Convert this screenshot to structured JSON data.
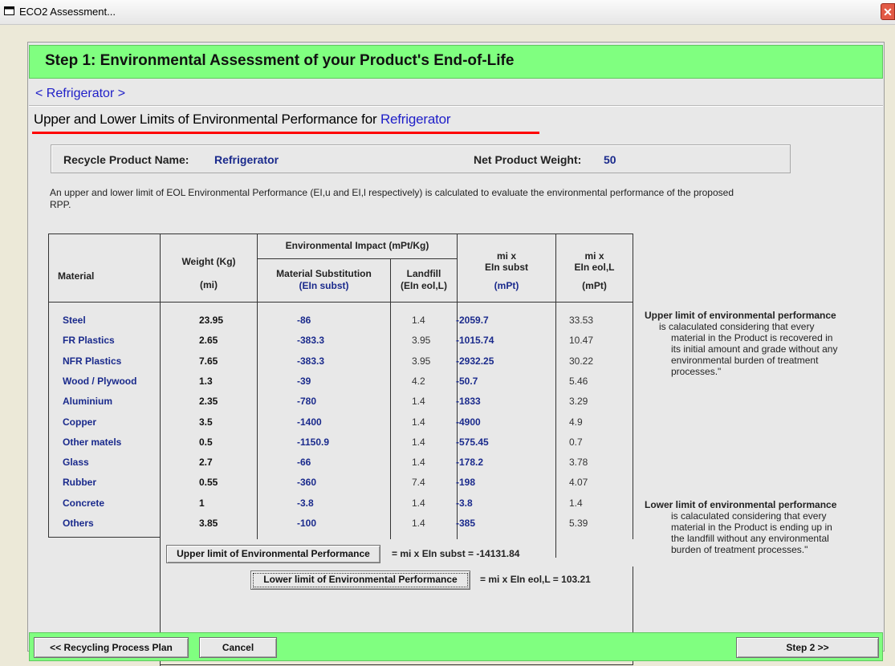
{
  "window": {
    "title": "ECO2 Assessment...",
    "close_glyph": "✕"
  },
  "header": {
    "title": "Step 1: Environmental Assessment of your Product's End-of-Life"
  },
  "breadcrumb": "< Refrigerator >",
  "section": {
    "heading_prefix": "Upper and Lower Limits of Environmental Performance for ",
    "heading_product": "Refrigerator"
  },
  "info": {
    "product_label": "Recycle Product Name:",
    "product_value": "Refrigerator",
    "weight_label": "Net Product Weight:",
    "weight_value": "50"
  },
  "description": "An upper and lower limit of EOL Environmental Performance (EI,u and EI,l respectively) is calculated to evaluate the environmental performance of the proposed RPP.",
  "table": {
    "headers": {
      "material": "Material",
      "weight": "Weight (Kg)",
      "weight_sub": "(mi)",
      "impact_group": "Environmental Impact (mPt/Kg)",
      "subst": "Material Substitution",
      "subst_sub": "(EIn subst)",
      "landfill": "Landfill",
      "landfill_sub": "(EIn eol,L)",
      "mi_subst_1": "mi x",
      "mi_subst_2": "EIn subst",
      "mi_subst_3": "(mPt)",
      "mi_eol_1": "mi x",
      "mi_eol_2": "EIn eol,L",
      "mi_eol_3": "(mPt)"
    },
    "rows": [
      {
        "material": "Steel",
        "weight": "23.95",
        "subst": "-86",
        "landfill": "1.4",
        "mi_subst": "-2059.7",
        "mi_eol": "33.53"
      },
      {
        "material": "FR Plastics",
        "weight": "2.65",
        "subst": "-383.3",
        "landfill": "3.95",
        "mi_subst": "-1015.74",
        "mi_eol": "10.47"
      },
      {
        "material": "NFR Plastics",
        "weight": "7.65",
        "subst": "-383.3",
        "landfill": "3.95",
        "mi_subst": "-2932.25",
        "mi_eol": "30.22"
      },
      {
        "material": "Wood / Plywood",
        "weight": "1.3",
        "subst": "-39",
        "landfill": "4.2",
        "mi_subst": "-50.7",
        "mi_eol": "5.46"
      },
      {
        "material": "Aluminium",
        "weight": "2.35",
        "subst": "-780",
        "landfill": "1.4",
        "mi_subst": "-1833",
        "mi_eol": "3.29"
      },
      {
        "material": "Copper",
        "weight": "3.5",
        "subst": "-1400",
        "landfill": "1.4",
        "mi_subst": "-4900",
        "mi_eol": "4.9"
      },
      {
        "material": "Other matels",
        "weight": "0.5",
        "subst": "-1150.9",
        "landfill": "1.4",
        "mi_subst": "-575.45",
        "mi_eol": "0.7"
      },
      {
        "material": "Glass",
        "weight": "2.7",
        "subst": "-66",
        "landfill": "1.4",
        "mi_subst": "-178.2",
        "mi_eol": "3.78"
      },
      {
        "material": "Rubber",
        "weight": "0.55",
        "subst": "-360",
        "landfill": "7.4",
        "mi_subst": "-198",
        "mi_eol": "4.07"
      },
      {
        "material": "Concrete",
        "weight": "1",
        "subst": "-3.8",
        "landfill": "1.4",
        "mi_subst": "-3.8",
        "mi_eol": "1.4"
      },
      {
        "material": "Others",
        "weight": "3.85",
        "subst": "-100",
        "landfill": "1.4",
        "mi_subst": "-385",
        "mi_eol": "5.39"
      }
    ]
  },
  "limits": {
    "upper_button": "Upper limit of Environmental Performance",
    "upper_formula": "= mi x  EIn subst = -14131.84",
    "lower_button": "Lower limit of Environmental Performance",
    "lower_formula": "= mi x  EIn eol,L = 103.21"
  },
  "notes": {
    "upper_title": "Upper limit of environmental performance",
    "upper_body": [
      "is calaculated considering that every",
      "material in the Product is recovered in",
      "its initial amount and grade without any",
      "environmental burden of treatment",
      "processes.\""
    ],
    "lower_title": "Lower limit of environmental performance",
    "lower_body": [
      "is calaculated considering that every",
      "material in the Product is ending up in",
      "the landfill without any environmental",
      "burden of treatment processes.\""
    ]
  },
  "footer": {
    "back_label": "<< Recycling Process Plan",
    "cancel_label": "Cancel",
    "next_label": "Step 2 >>"
  }
}
